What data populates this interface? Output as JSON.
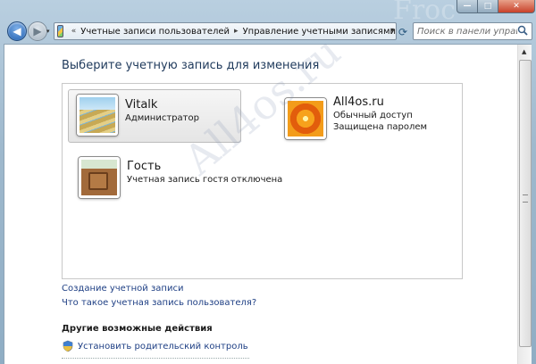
{
  "window": {
    "watermark": "All4os.ru",
    "watermark_top": "Froc"
  },
  "titlebar": {
    "minimize_glyph": "—",
    "maximize_glyph": "□",
    "close_glyph": "✕"
  },
  "nav": {
    "back_glyph": "◀",
    "forward_glyph": "▶",
    "history_glyph": "▾"
  },
  "address": {
    "separator": "«",
    "crumbs": [
      "Учетные записи пользователей",
      "Управление учетными записями"
    ],
    "crumb_sep": "▸",
    "dropdown_glyph": "▾",
    "refresh_glyph": "⟳"
  },
  "search": {
    "placeholder": "Поиск в панели управл...",
    "icon": "search-icon"
  },
  "main": {
    "heading": "Выберите учетную запись для изменения",
    "accounts": [
      {
        "name": "Vitalk",
        "lines": [
          "Администратор"
        ],
        "picture": "stairs",
        "selected": true
      },
      {
        "name": "All4os.ru",
        "lines": [
          "Обычный доступ",
          "Защищена паролем"
        ],
        "picture": "flower",
        "selected": false
      },
      {
        "name": "Гость",
        "lines": [
          "Учетная запись гостя отключена"
        ],
        "picture": "briefcase",
        "selected": false
      }
    ],
    "links": {
      "create": "Создание учетной записи",
      "what_is": "Что такое учетная запись пользователя?"
    },
    "other_actions": {
      "heading": "Другие возможные действия",
      "parental_control": "Установить родительский контроль"
    }
  },
  "colors": {
    "link": "#1e3f84",
    "heading": "#1e395b",
    "selected_background": "#eeeeee"
  }
}
